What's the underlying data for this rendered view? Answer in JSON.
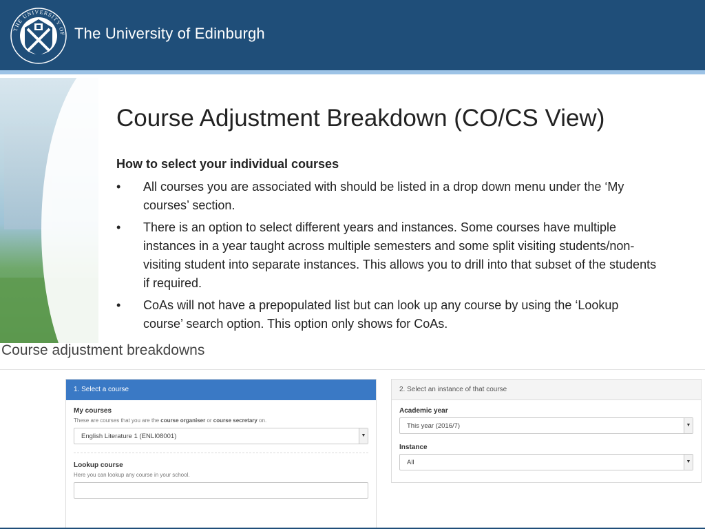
{
  "header": {
    "university_name": "The University of Edinburgh",
    "crest_text": "THE UNIVERSITY OF EDINBURGH",
    "colors": {
      "band": "#1f4e79",
      "stripe": "#9dc3e6"
    }
  },
  "slide": {
    "title": "Course Adjustment Breakdown (CO/CS View)",
    "subheading": "How to select your individual courses",
    "bullet_char": "•",
    "bullets": [
      "All courses you are associated with should be listed in a drop down menu under the ‘My courses’ section.",
      "There is an option to select different years and instances.  Some courses have multiple instances in a year taught across multiple semesters and some split visiting students/non-visiting student into separate instances. This allows you to drill into that subset of the students if required.",
      "CoAs will not have a prepopulated list but can look up any course by using the ‘Lookup course’ search option.  This option only shows for CoAs."
    ]
  },
  "app": {
    "title": "Course adjustment breakdowns",
    "select_course_panel": {
      "heading": "1. Select a course",
      "my_courses_label": "My courses",
      "my_courses_help_prefix": "These are courses that you are the ",
      "my_courses_help_role1": "course organiser",
      "my_courses_help_mid": " or ",
      "my_courses_help_role2": "course secretary",
      "my_courses_help_suffix": " on.",
      "my_courses_selected": "English Literature 1 (ENLI08001)",
      "lookup_label": "Lookup course",
      "lookup_help": "Here you can lookup any course in your school.",
      "lookup_value": ""
    },
    "instance_panel": {
      "heading": "2. Select an instance of that course",
      "academic_year_label": "Academic year",
      "academic_year_selected": "This year (2016/7)",
      "instance_label": "Instance",
      "instance_selected": "All"
    },
    "icons": {
      "dropdown": "chevron-down-icon",
      "caret_glyph": "▼"
    },
    "colors": {
      "active_panel_header": "#3a79c5"
    }
  }
}
